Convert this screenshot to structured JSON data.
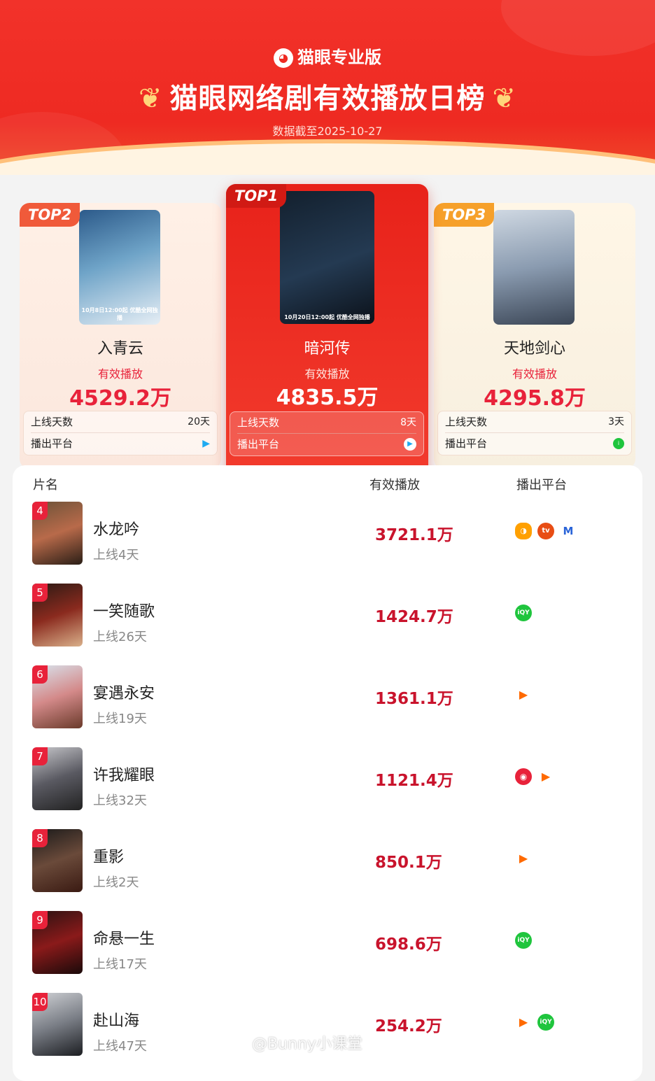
{
  "header": {
    "brand": "猫眼专业版",
    "title": "猫眼网络剧有效播放日榜",
    "subtitle": "数据截至2025-10-27"
  },
  "top_cards": {
    "top1": {
      "rank": "TOP1",
      "name": "暗河传",
      "play_label": "有效播放",
      "play": "4835.5万",
      "days_label": "上线天数",
      "days": "8天",
      "platform_label": "播出平台",
      "poster_caption": "10月20日12:00起 优酷全网独播"
    },
    "top2": {
      "rank": "TOP2",
      "name": "入青云",
      "play_label": "有效播放",
      "play": "4529.2万",
      "days_label": "上线天数",
      "days": "20天",
      "platform_label": "播出平台",
      "poster_caption": "10月8日12:00起 优酷全网独播"
    },
    "top3": {
      "rank": "TOP3",
      "name": "天地剑心",
      "play_label": "有效播放",
      "play": "4295.8万",
      "days_label": "上线天数",
      "days": "3天",
      "platform_label": "播出平台"
    }
  },
  "table": {
    "headers": {
      "name": "片名",
      "play": "有效播放",
      "platform": "播出平台"
    },
    "rows": [
      {
        "rank": "4",
        "title": "水龙吟",
        "days": "上线4天",
        "play": "3721.1万",
        "platforms": [
          "mango-icon",
          "cctv-icon",
          "mgtv-icon"
        ]
      },
      {
        "rank": "5",
        "title": "一笑随歌",
        "days": "上线26天",
        "play": "1424.7万",
        "platforms": [
          "iqiyi-icon"
        ]
      },
      {
        "rank": "6",
        "title": "宴遇永安",
        "days": "上线19天",
        "play": "1361.1万",
        "platforms": [
          "tencent-icon"
        ]
      },
      {
        "rank": "7",
        "title": "许我耀眼",
        "days": "上线32天",
        "play": "1121.4万",
        "platforms": [
          "weibo-icon",
          "tencent-icon"
        ]
      },
      {
        "rank": "8",
        "title": "重影",
        "days": "上线2天",
        "play": "850.1万",
        "platforms": [
          "tencent-icon"
        ]
      },
      {
        "rank": "9",
        "title": "命悬一生",
        "days": "上线17天",
        "play": "698.6万",
        "platforms": [
          "iqiyi-icon"
        ]
      },
      {
        "rank": "10",
        "title": "赴山海",
        "days": "上线47天",
        "play": "254.2万",
        "platforms": [
          "tencent-icon",
          "iqiyi-icon"
        ]
      }
    ]
  },
  "watermark": "@Bunny小课堂",
  "colors": {
    "accent": "#e8223a",
    "header_red": "#ee2a22",
    "top2_badge": "#f05a3a",
    "top3_badge": "#f6a02a"
  }
}
